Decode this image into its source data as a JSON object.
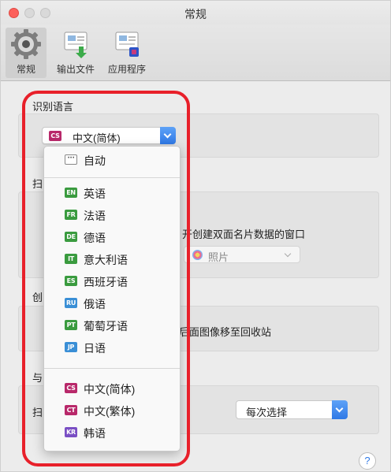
{
  "window": {
    "title": "常规"
  },
  "toolbar": {
    "items": [
      {
        "label": "常规",
        "icon": "gear-icon",
        "selected": true
      },
      {
        "label": "输出文件",
        "icon": "output-file-icon",
        "selected": false
      },
      {
        "label": "应用程序",
        "icon": "application-icon",
        "selected": false
      }
    ]
  },
  "recognize_language": {
    "title": "识别语言",
    "selected_flag": "CS",
    "selected_value": "中文(简体)"
  },
  "partial_headers": {
    "scan_header": "扫",
    "create_header": "创",
    "other_header": "与",
    "other_label": "扫"
  },
  "background_text": {
    "duplex_window": "开创建双面名片数据的窗口",
    "photo_option": "照片",
    "move_to_trash": "后面图像移至回收站",
    "every_time": "每次选择"
  },
  "help_label": "?",
  "dropdown": {
    "items": [
      {
        "flag": "···",
        "label": "自动",
        "color": "#ffffff"
      },
      {
        "flag": "EN",
        "label": "英语",
        "color": "#3a9b3f"
      },
      {
        "flag": "FR",
        "label": "法语",
        "color": "#3a9b3f"
      },
      {
        "flag": "DE",
        "label": "德语",
        "color": "#3a9b3f"
      },
      {
        "flag": "IT",
        "label": "意大利语",
        "color": "#3a9b3f"
      },
      {
        "flag": "ES",
        "label": "西班牙语",
        "color": "#3a9b3f"
      },
      {
        "flag": "RU",
        "label": "俄语",
        "color": "#3a8fd6"
      },
      {
        "flag": "PT",
        "label": "葡萄牙语",
        "color": "#3a9b3f"
      },
      {
        "flag": "JP",
        "label": "日语",
        "color": "#3a8fd6"
      },
      {
        "flag": "CS",
        "label": "中文(简体)",
        "color": "#b8286a"
      },
      {
        "flag": "CT",
        "label": "中文(繁体)",
        "color": "#b8286a"
      },
      {
        "flag": "KR",
        "label": "韩语",
        "color": "#7a4fc4"
      }
    ]
  },
  "colors": {
    "accent": "#2f79e6",
    "annotation": "#e8202a",
    "close": "#fc605b"
  }
}
